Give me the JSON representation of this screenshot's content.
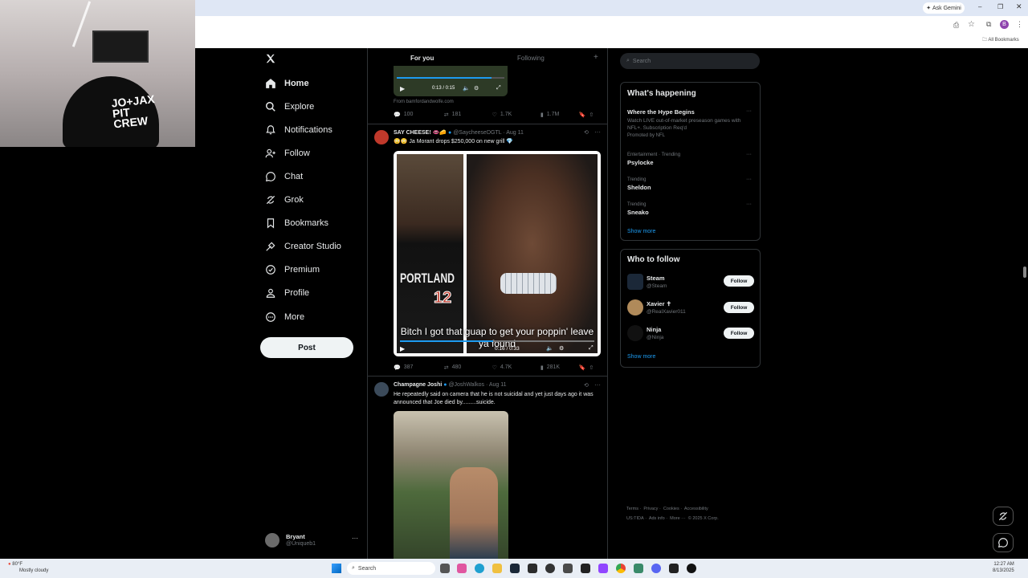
{
  "browser": {
    "ask_gemini": "Ask Gemini",
    "all_bookmarks": "All Bookmarks",
    "profile_initial": "B"
  },
  "webcam": {
    "hat_text": "JO+JAX PIT CREW"
  },
  "nav": {
    "items": [
      {
        "label": "Home",
        "icon": "home-icon"
      },
      {
        "label": "Explore",
        "icon": "search-icon"
      },
      {
        "label": "Notifications",
        "icon": "bell-icon"
      },
      {
        "label": "Follow",
        "icon": "person-add-icon"
      },
      {
        "label": "Chat",
        "icon": "chat-icon"
      },
      {
        "label": "Grok",
        "icon": "grok-icon"
      },
      {
        "label": "Bookmarks",
        "icon": "bookmark-icon"
      },
      {
        "label": "Creator Studio",
        "icon": "creator-icon"
      },
      {
        "label": "Premium",
        "icon": "premium-icon"
      },
      {
        "label": "Profile",
        "icon": "profile-icon"
      },
      {
        "label": "More",
        "icon": "more-icon"
      }
    ],
    "post_label": "Post",
    "user_name": "Bryant",
    "user_handle": "@Uniqueb1"
  },
  "timeline": {
    "tabs": [
      "For you",
      "Following"
    ],
    "top_tweet": {
      "video_time": "0:13 / 0:15",
      "source": "From bamfordandwolfe.com",
      "stats": {
        "replies": "100",
        "reposts": "181",
        "likes": "1.7K",
        "views": "1.7M"
      }
    },
    "tweet1": {
      "name": "SAY CHEESE! 👄🧀",
      "handle": "@SaycheeseDGTL",
      "date": "· Aug 11",
      "text": "😳😳 Ja Morant drops $250,000 on new grill 💎",
      "caption": "Bitch I got that guap to get your poppin' leave ya found",
      "video_time": "0:16 / 0:33",
      "jersey_text": "PORTLAND",
      "jersey_number": "12",
      "stats": {
        "replies": "387",
        "reposts": "480",
        "likes": "4.7K",
        "views": "281K"
      }
    },
    "tweet2": {
      "name": "Champagne Joshi",
      "handle": "@JoshWalkos",
      "date": "· Aug 11",
      "text": "He repeatedly said on camera that he is not suicidal and yet just days ago it was announced that Joe died by.........suicide."
    }
  },
  "right": {
    "search_placeholder": "Search",
    "happening_title": "What's happening",
    "trends": [
      {
        "title": "Where the Hype Begins",
        "desc": "Watch LIVE out-of-market preseason games with NFL+. Subscription Req'd",
        "meta": "Promoted by NFL"
      },
      {
        "meta": "Entertainment · Trending",
        "title": "Psylocke"
      },
      {
        "meta": "Trending",
        "title": "Sheldon"
      },
      {
        "meta": "Trending",
        "title": "Sneako"
      }
    ],
    "show_more": "Show more",
    "who_title": "Who to follow",
    "follow_label": "Follow",
    "accounts": [
      {
        "name": "Steam",
        "handle": "@Steam"
      },
      {
        "name": "Xavier ✝",
        "handle": "@RealXavier011"
      },
      {
        "name": "Ninja",
        "handle": "@Ninja"
      }
    ],
    "footer": [
      "Terms",
      "Privacy",
      "Cookies",
      "Accessibility",
      "US:TIDA",
      "Ads info",
      "More ···",
      "© 2025 X Corp."
    ]
  },
  "taskbar": {
    "weather_temp": "80°F",
    "weather_desc": "Mostly cloudy",
    "search_label": "Search",
    "time": "12:27 AM",
    "date": "8/13/2025"
  },
  "colors": {
    "accent": "#1d9bf0",
    "bg": "#000000",
    "border": "#2f3336"
  }
}
